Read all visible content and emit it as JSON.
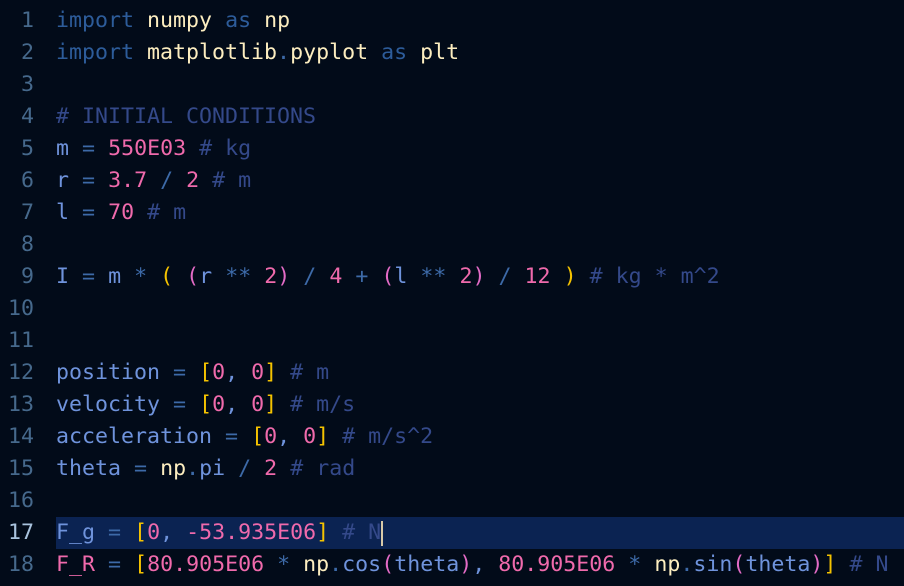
{
  "editor": {
    "active_line": 17,
    "cursor_after_line_17": true,
    "lines": [
      {
        "n": "1",
        "tokens": [
          [
            "kw",
            "import"
          ],
          [
            "sp",
            " "
          ],
          [
            "mod",
            "numpy"
          ],
          [
            "sp",
            " "
          ],
          [
            "kw",
            "as"
          ],
          [
            "sp",
            " "
          ],
          [
            "mod",
            "np"
          ]
        ]
      },
      {
        "n": "2",
        "tokens": [
          [
            "kw",
            "import"
          ],
          [
            "sp",
            " "
          ],
          [
            "mod",
            "matplotlib"
          ],
          [
            "op",
            "."
          ],
          [
            "mod",
            "pyplot"
          ],
          [
            "sp",
            " "
          ],
          [
            "kw",
            "as"
          ],
          [
            "sp",
            " "
          ],
          [
            "mod",
            "plt"
          ]
        ]
      },
      {
        "n": "3",
        "tokens": []
      },
      {
        "n": "4",
        "tokens": [
          [
            "com",
            "# INITIAL CONDITIONS"
          ]
        ]
      },
      {
        "n": "5",
        "tokens": [
          [
            "id",
            "m"
          ],
          [
            "sp",
            " "
          ],
          [
            "op",
            "="
          ],
          [
            "sp",
            " "
          ],
          [
            "num",
            "550E03"
          ],
          [
            "sp",
            " "
          ],
          [
            "com",
            "# kg"
          ]
        ]
      },
      {
        "n": "6",
        "tokens": [
          [
            "id",
            "r"
          ],
          [
            "sp",
            " "
          ],
          [
            "op",
            "="
          ],
          [
            "sp",
            " "
          ],
          [
            "num",
            "3.7"
          ],
          [
            "sp",
            " "
          ],
          [
            "op",
            "/"
          ],
          [
            "sp",
            " "
          ],
          [
            "num",
            "2"
          ],
          [
            "sp",
            " "
          ],
          [
            "com",
            "# m"
          ]
        ]
      },
      {
        "n": "7",
        "tokens": [
          [
            "id",
            "l"
          ],
          [
            "sp",
            " "
          ],
          [
            "op",
            "="
          ],
          [
            "sp",
            " "
          ],
          [
            "num",
            "70"
          ],
          [
            "sp",
            " "
          ],
          [
            "com",
            "# m"
          ]
        ]
      },
      {
        "n": "8",
        "tokens": []
      },
      {
        "n": "9",
        "tokens": [
          [
            "id",
            "I"
          ],
          [
            "sp",
            " "
          ],
          [
            "op",
            "="
          ],
          [
            "sp",
            " "
          ],
          [
            "id",
            "m"
          ],
          [
            "sp",
            " "
          ],
          [
            "op",
            "*"
          ],
          [
            "sp",
            " "
          ],
          [
            "brk",
            "("
          ],
          [
            "sp",
            " "
          ],
          [
            "par",
            "("
          ],
          [
            "id",
            "r"
          ],
          [
            "sp",
            " "
          ],
          [
            "op",
            "**"
          ],
          [
            "sp",
            " "
          ],
          [
            "num",
            "2"
          ],
          [
            "par",
            ")"
          ],
          [
            "sp",
            " "
          ],
          [
            "op",
            "/"
          ],
          [
            "sp",
            " "
          ],
          [
            "num",
            "4"
          ],
          [
            "sp",
            " "
          ],
          [
            "op",
            "+"
          ],
          [
            "sp",
            " "
          ],
          [
            "par",
            "("
          ],
          [
            "id",
            "l"
          ],
          [
            "sp",
            " "
          ],
          [
            "op",
            "**"
          ],
          [
            "sp",
            " "
          ],
          [
            "num",
            "2"
          ],
          [
            "par",
            ")"
          ],
          [
            "sp",
            " "
          ],
          [
            "op",
            "/"
          ],
          [
            "sp",
            " "
          ],
          [
            "num",
            "12"
          ],
          [
            "sp",
            " "
          ],
          [
            "brk",
            ")"
          ],
          [
            "sp",
            " "
          ],
          [
            "com",
            "# kg * m^2"
          ]
        ]
      },
      {
        "n": "10",
        "tokens": []
      },
      {
        "n": "11",
        "tokens": []
      },
      {
        "n": "12",
        "tokens": [
          [
            "id",
            "position"
          ],
          [
            "sp",
            " "
          ],
          [
            "op",
            "="
          ],
          [
            "sp",
            " "
          ],
          [
            "brk",
            "["
          ],
          [
            "num",
            "0"
          ],
          [
            "pun",
            ","
          ],
          [
            "sp",
            " "
          ],
          [
            "num",
            "0"
          ],
          [
            "brk",
            "]"
          ],
          [
            "sp",
            " "
          ],
          [
            "com",
            "# m"
          ]
        ]
      },
      {
        "n": "13",
        "tokens": [
          [
            "id",
            "velocity"
          ],
          [
            "sp",
            " "
          ],
          [
            "op",
            "="
          ],
          [
            "sp",
            " "
          ],
          [
            "brk",
            "["
          ],
          [
            "num",
            "0"
          ],
          [
            "pun",
            ","
          ],
          [
            "sp",
            " "
          ],
          [
            "num",
            "0"
          ],
          [
            "brk",
            "]"
          ],
          [
            "sp",
            " "
          ],
          [
            "com",
            "# m/s"
          ]
        ]
      },
      {
        "n": "14",
        "tokens": [
          [
            "id",
            "acceleration"
          ],
          [
            "sp",
            " "
          ],
          [
            "op",
            "="
          ],
          [
            "sp",
            " "
          ],
          [
            "brk",
            "["
          ],
          [
            "num",
            "0"
          ],
          [
            "pun",
            ","
          ],
          [
            "sp",
            " "
          ],
          [
            "num",
            "0"
          ],
          [
            "brk",
            "]"
          ],
          [
            "sp",
            " "
          ],
          [
            "com",
            "# m/s^2"
          ]
        ]
      },
      {
        "n": "15",
        "tokens": [
          [
            "id",
            "theta"
          ],
          [
            "sp",
            " "
          ],
          [
            "op",
            "="
          ],
          [
            "sp",
            " "
          ],
          [
            "mod",
            "np"
          ],
          [
            "op",
            "."
          ],
          [
            "id",
            "pi"
          ],
          [
            "sp",
            " "
          ],
          [
            "op",
            "/"
          ],
          [
            "sp",
            " "
          ],
          [
            "num",
            "2"
          ],
          [
            "sp",
            " "
          ],
          [
            "com",
            "# rad"
          ]
        ]
      },
      {
        "n": "16",
        "tokens": []
      },
      {
        "n": "17",
        "tokens": [
          [
            "id",
            "F_g"
          ],
          [
            "sp",
            " "
          ],
          [
            "op",
            "="
          ],
          [
            "sp",
            " "
          ],
          [
            "brk",
            "["
          ],
          [
            "num",
            "0"
          ],
          [
            "pun",
            ","
          ],
          [
            "sp",
            " "
          ],
          [
            "num",
            "-53.935E06"
          ],
          [
            "brk",
            "]"
          ],
          [
            "sp",
            " "
          ],
          [
            "com",
            "# N"
          ]
        ]
      },
      {
        "n": "18",
        "tokens": [
          [
            "const",
            "F_R"
          ],
          [
            "sp",
            " "
          ],
          [
            "op",
            "="
          ],
          [
            "sp",
            " "
          ],
          [
            "brk",
            "["
          ],
          [
            "num",
            "80.905E06"
          ],
          [
            "sp",
            " "
          ],
          [
            "op",
            "*"
          ],
          [
            "sp",
            " "
          ],
          [
            "mod",
            "np"
          ],
          [
            "op",
            "."
          ],
          [
            "id",
            "cos"
          ],
          [
            "par",
            "("
          ],
          [
            "id",
            "theta"
          ],
          [
            "par",
            ")"
          ],
          [
            "pun",
            ","
          ],
          [
            "sp",
            " "
          ],
          [
            "num",
            "80.905E06"
          ],
          [
            "sp",
            " "
          ],
          [
            "op",
            "*"
          ],
          [
            "sp",
            " "
          ],
          [
            "mod",
            "np"
          ],
          [
            "op",
            "."
          ],
          [
            "id",
            "sin"
          ],
          [
            "par",
            "("
          ],
          [
            "id",
            "theta"
          ],
          [
            "par",
            ")"
          ],
          [
            "brk",
            "]"
          ],
          [
            "sp",
            " "
          ],
          [
            "com",
            "# N"
          ]
        ]
      }
    ]
  },
  "colors": {
    "background": "#020b19",
    "selection": "#0b2352",
    "line_number": "#46698c",
    "keyword": "#2d5c9a",
    "module": "#fdeec0",
    "identifier": "#6f93dc",
    "number": "#f06aac",
    "comment": "#34498a",
    "bracket": "#f5c300"
  }
}
